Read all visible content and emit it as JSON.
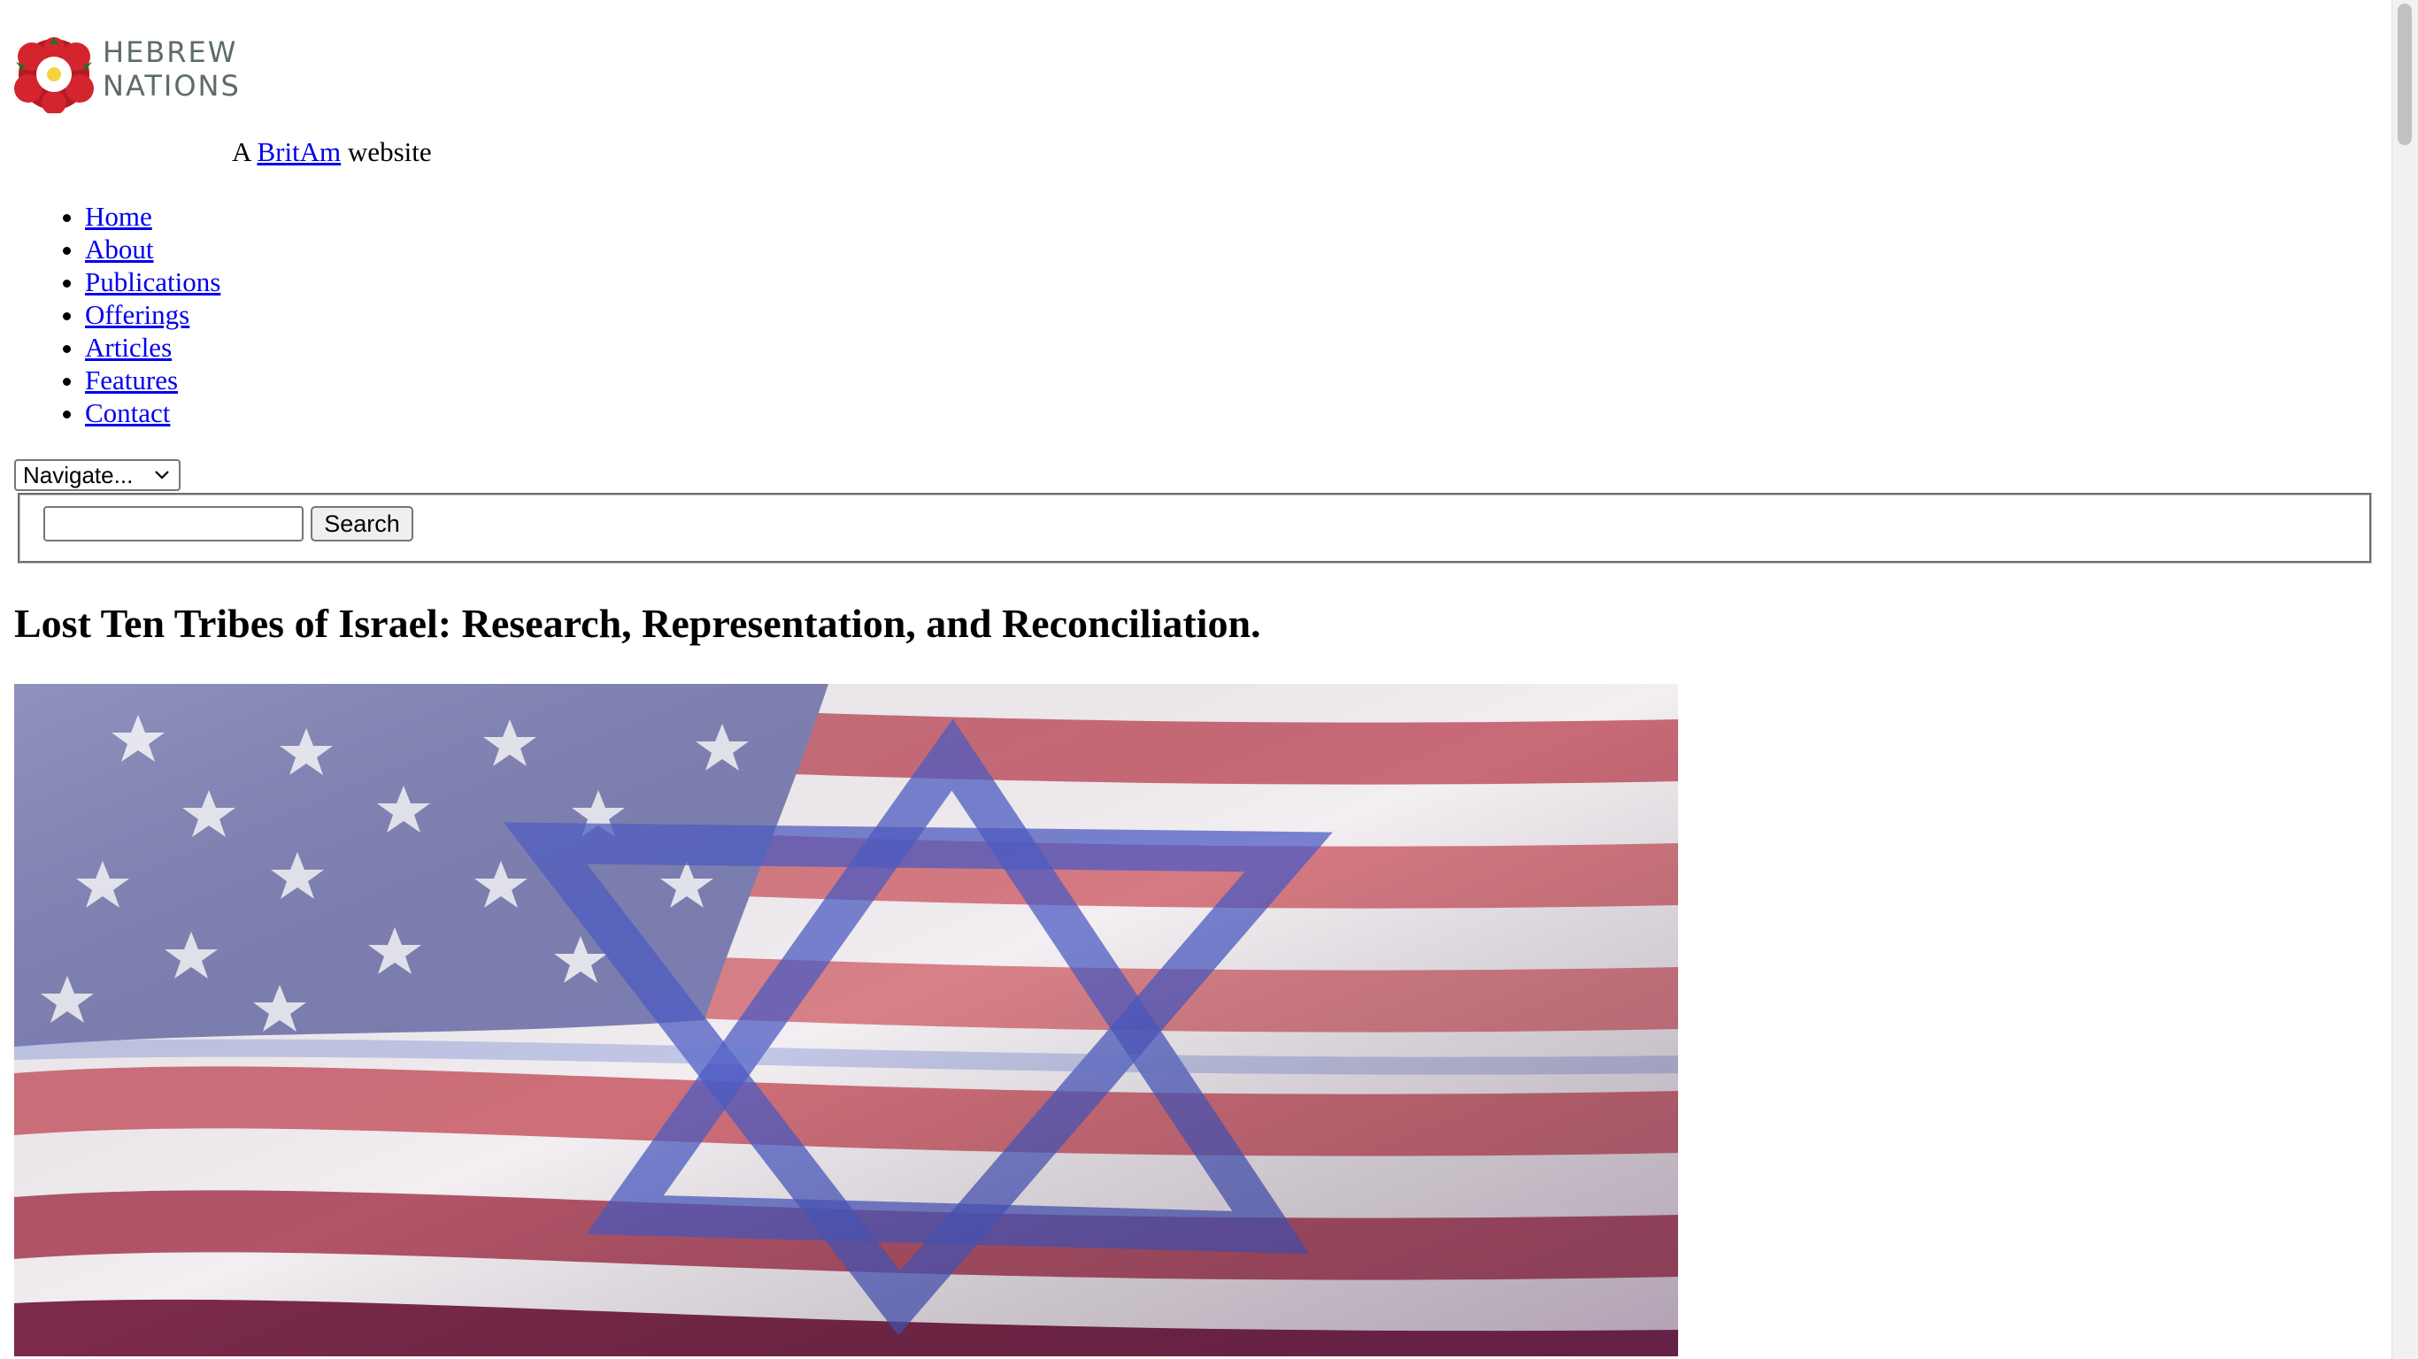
{
  "header": {
    "logo_line1": "HEBREW",
    "logo_line2": "NATIONS",
    "tagline_prefix": "A ",
    "tagline_link": "BritAm",
    "tagline_suffix": " website"
  },
  "nav": {
    "items": [
      {
        "label": "Home"
      },
      {
        "label": "About"
      },
      {
        "label": "Publications"
      },
      {
        "label": "Offerings"
      },
      {
        "label": "Articles"
      },
      {
        "label": "Features"
      },
      {
        "label": "Contact"
      }
    ],
    "select_value": "Navigate..."
  },
  "search": {
    "value": "",
    "button_label": "Search"
  },
  "main": {
    "title": "Lost Ten Tribes of Israel: Research, Representation, and Reconciliation."
  },
  "colors": {
    "link": "#0000ee",
    "logo_text": "#5e6b6b",
    "rose_red": "#c0202a"
  }
}
